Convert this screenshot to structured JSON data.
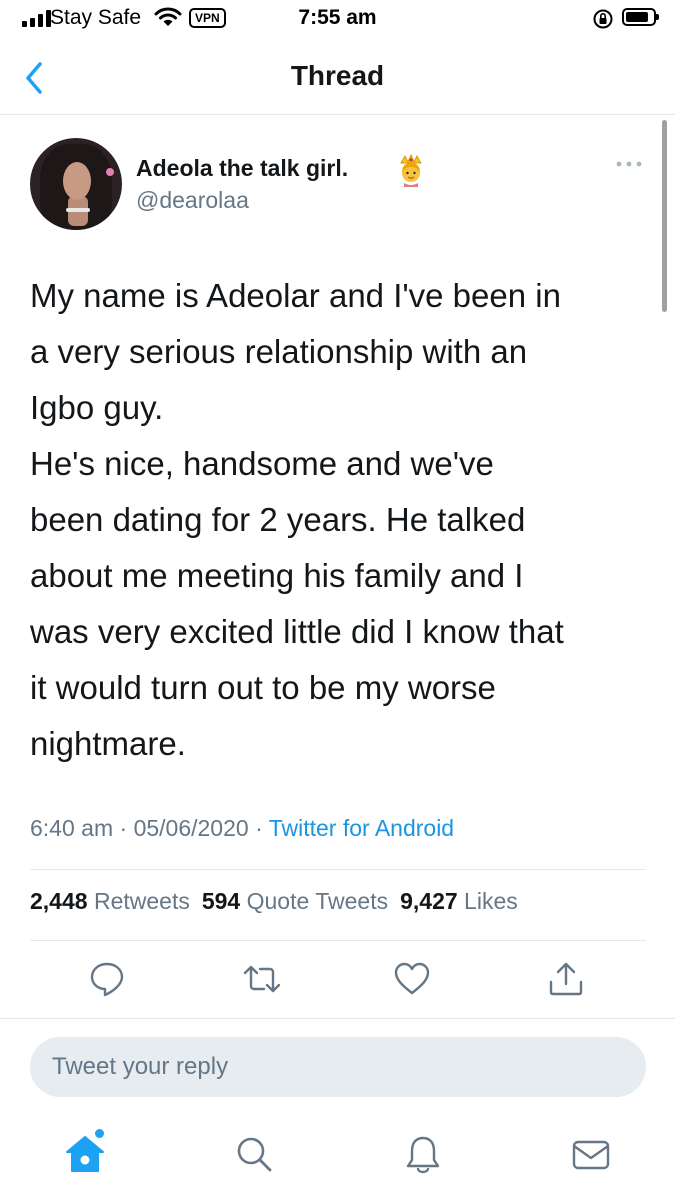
{
  "status_bar": {
    "carrier": "Stay Safe",
    "vpn": "VPN",
    "time": "7:55 am",
    "icons": [
      "signal-icon",
      "wifi-icon",
      "orientation-lock-icon",
      "battery-icon"
    ]
  },
  "header": {
    "title": "Thread",
    "back_icon": "chevron-left-icon"
  },
  "tweet": {
    "author_name": "Adeola the talk girl.",
    "author_emoji": "princess-emoji",
    "handle": "@dearolaa",
    "text_lines": [
      "My name is Adeolar and I've been in",
      "a very serious relationship with an",
      "Igbo guy.",
      "He's nice, handsome and we've",
      "been dating for 2 years. He talked",
      "about me meeting his family and I",
      "was very excited little did I know that",
      "it would turn out to be my worse",
      "nightmare."
    ],
    "time": "6:40 am",
    "separator": "·",
    "date": "05/06/2020",
    "source": "Twitter for Android",
    "stats": {
      "retweets_count": "2,448",
      "retweets_label": "Retweets",
      "quotes_count": "594",
      "quotes_label": "Quote Tweets",
      "likes_count": "9,427",
      "likes_label": "Likes"
    }
  },
  "actions": [
    "reply-icon",
    "retweet-icon",
    "like-icon",
    "share-icon"
  ],
  "reply_box": {
    "placeholder": "Tweet your reply"
  },
  "tab_bar": {
    "items": [
      "home-icon",
      "search-icon",
      "notifications-icon",
      "messages-icon"
    ]
  },
  "colors": {
    "accent": "#1da1f2",
    "link": "#1b95e0",
    "secondary_text": "#657786",
    "primary_text": "#14171a",
    "input_bg": "#e6ecf0"
  }
}
